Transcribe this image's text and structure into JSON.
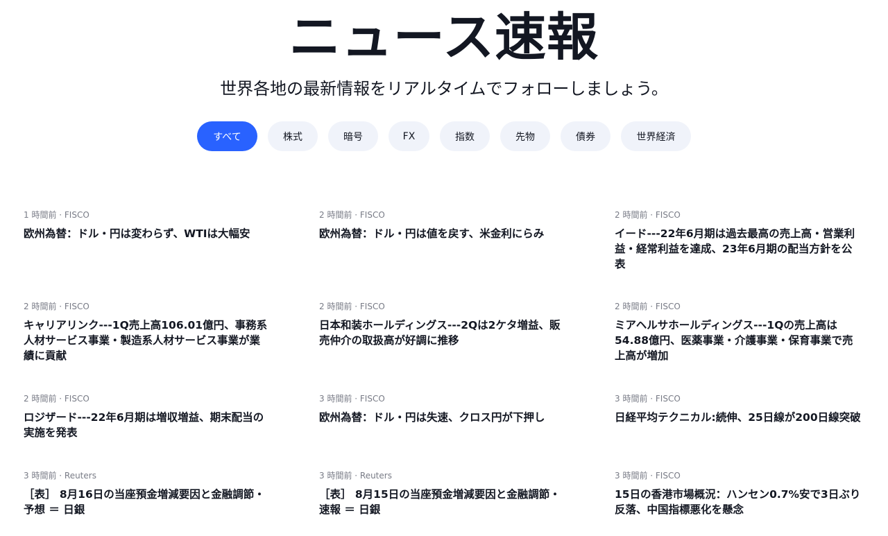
{
  "header": {
    "title": "ニュース速報",
    "subtitle": "世界各地の最新情報をリアルタイムでフォローしましょう。"
  },
  "tabs": [
    {
      "label": "すべて",
      "active": true
    },
    {
      "label": "株式",
      "active": false
    },
    {
      "label": "暗号",
      "active": false
    },
    {
      "label": "FX",
      "active": false
    },
    {
      "label": "指数",
      "active": false
    },
    {
      "label": "先物",
      "active": false
    },
    {
      "label": "債券",
      "active": false
    },
    {
      "label": "世界経済",
      "active": false
    }
  ],
  "news": [
    {
      "meta": "1 時間前 · FISCO",
      "title": "欧州為替：ドル・円は変わらず、WTIは大幅安"
    },
    {
      "meta": "2 時間前 · FISCO",
      "title": "欧州為替：ドル・円は値を戻す、米金利にらみ"
    },
    {
      "meta": "2 時間前 · FISCO",
      "title": "イード---22年6月期は過去最高の売上高・営業利益・経常利益を達成、23年6月期の配当方針を公表"
    },
    {
      "meta": "2 時間前 · FISCO",
      "title": "キャリアリンク---1Q売上高106.01億円、事務系人材サービス事業・製造系人材サービス事業が業績に貢献"
    },
    {
      "meta": "2 時間前 · FISCO",
      "title": "日本和装ホールディングス---2Qは2ケタ増益、販売仲介の取扱高が好調に推移"
    },
    {
      "meta": "2 時間前 · FISCO",
      "title": "ミアヘルサホールディングス---1Qの売上高は54.88億円、医薬事業・介護事業・保育事業で売上高が増加"
    },
    {
      "meta": "2 時間前 · FISCO",
      "title": "ロジザード---22年6月期は増収増益、期末配当の実施を発表"
    },
    {
      "meta": "3 時間前 · FISCO",
      "title": "欧州為替：ドル・円は失速、クロス円が下押し"
    },
    {
      "meta": "3 時間前 · FISCO",
      "title": "日経平均テクニカル:続伸、25日線が200日線突破"
    },
    {
      "meta": "3 時間前 · Reuters",
      "title": "［表］ 8月16日の当座預金増減要因と金融調節・予想 ＝ 日銀"
    },
    {
      "meta": "3 時間前 · Reuters",
      "title": "［表］ 8月15日の当座預金増減要因と金融調節・速報 ＝ 日銀"
    },
    {
      "meta": "3 時間前 · FISCO",
      "title": "15日の香港市場概況：ハンセン0.7%安で3日ぶり反落、中国指標悪化を懸念"
    }
  ]
}
